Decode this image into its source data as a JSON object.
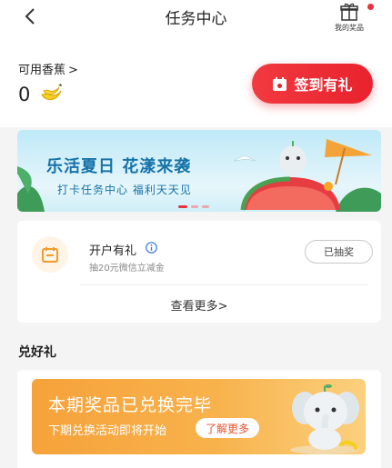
{
  "header": {
    "title": "任务中心",
    "gift_label": "我的奖品"
  },
  "balance": {
    "label": "可用香蕉",
    "chevron": ">",
    "count": "0"
  },
  "checkin_button": {
    "label": "签到有礼"
  },
  "banner": {
    "headline": "乐活夏日  花漾来袭",
    "subline": "打卡任务中心 福利天天见",
    "page_count": 3,
    "active_page": 1
  },
  "task": {
    "name": "开户有礼",
    "desc": "抽20元微信立减金",
    "status_button": "已抽奖"
  },
  "view_more": {
    "label": "查看更多",
    "chevron": ">"
  },
  "redeem": {
    "section_title": "兑好礼",
    "title": "本期奖品已兑换完毕",
    "subtitle": "下期兑换活动即将开始",
    "button": "了解更多"
  },
  "colors": {
    "accent": "#e8323c",
    "banner_text": "#1673a8",
    "redeem_orange": "#f6a23a"
  }
}
